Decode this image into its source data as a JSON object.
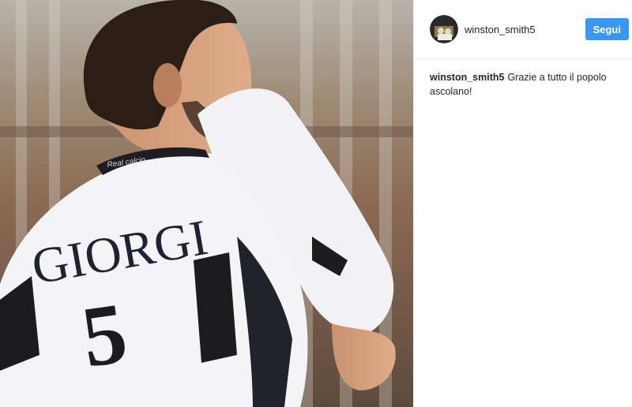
{
  "post": {
    "username": "winston_smith5",
    "follow_label": "Segui",
    "caption": {
      "username": "winston_smith5",
      "text": "Grazie a tutto il popolo ascolano!"
    },
    "photo": {
      "jersey_name": "GIORGI",
      "jersey_number": "5",
      "collar_text": "Real calcio"
    }
  }
}
